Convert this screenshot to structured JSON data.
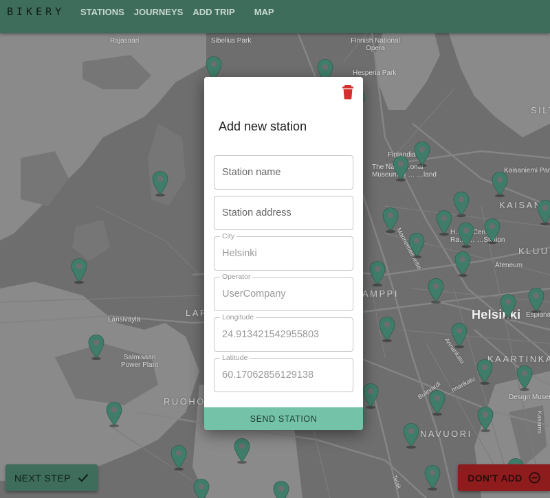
{
  "header": {
    "brand": "BIKERY",
    "nav": [
      "STATIONS",
      "JOURNEYS",
      "ADD TRIP",
      "MAP"
    ]
  },
  "map": {
    "labels": {
      "rajasaari": "Rajasaari",
      "sibelius_park": "Sibelius Park",
      "finnish_national_opera": "Finnish National\nOpera",
      "hesperia_park": "Hesperia Park",
      "silta": "SILT",
      "finlandia": "Finlandia",
      "national_museum": "The Na… …onal\nMuseum of … …land",
      "kaisaniemi_park": "Kaisaniemi Par",
      "kaisaniemi": "KAISANIE",
      "railway_station": "H… … Cen…\nRa… … …Station",
      "kluuvi": "KLUU",
      "mannerheimintie": "Mannerheimintie",
      "ateneum": "Ateneum",
      "kamppi": "AMPPI",
      "helsinki": "Helsinki",
      "esplanadi": "Esplana",
      "lansivayla": "Länsiväylä",
      "salmisaari": "Salmisaari\nPower Plant",
      "kaartinkaupunki": "KAARTINKAU",
      "annankatu": "Annankatu",
      "ruoholahti": "RUOHOL",
      "bulevardi": "Bulevardi",
      "design_museum": "Design Museu",
      "punavuori": "NAVUORI",
      "lapinlahti": "LAF",
      "kalevankatu": "…nnankatu",
      "telakkakatu": "Telak",
      "kasarmikatu": "Kasarmi"
    }
  },
  "modal": {
    "title": "Add new station",
    "fields": {
      "name": {
        "placeholder": "Station name",
        "value": ""
      },
      "address": {
        "placeholder": "Station address",
        "value": ""
      },
      "city": {
        "label": "City",
        "value": "Helsinki"
      },
      "operator": {
        "label": "Operator",
        "value": "UserCompany"
      },
      "longitude": {
        "label": "Longitude",
        "value": "24.913421542955803"
      },
      "latitude": {
        "label": "Latitude",
        "value": "60.17062856129138"
      }
    },
    "submit_label": "SEND STATION",
    "delete_icon": "trash-icon"
  },
  "actions": {
    "next_step_label": "NEXT STEP",
    "next_step_icon": "check-icon",
    "dont_add_label": "DON'T ADD",
    "dont_add_icon": "circle-minus-icon"
  },
  "colors": {
    "header": "#3f6d5c",
    "pin": "#3f7d6a",
    "send_button": "#74c2a8",
    "dont_add": "#8f1c1c",
    "trash": "#d32f2f"
  }
}
